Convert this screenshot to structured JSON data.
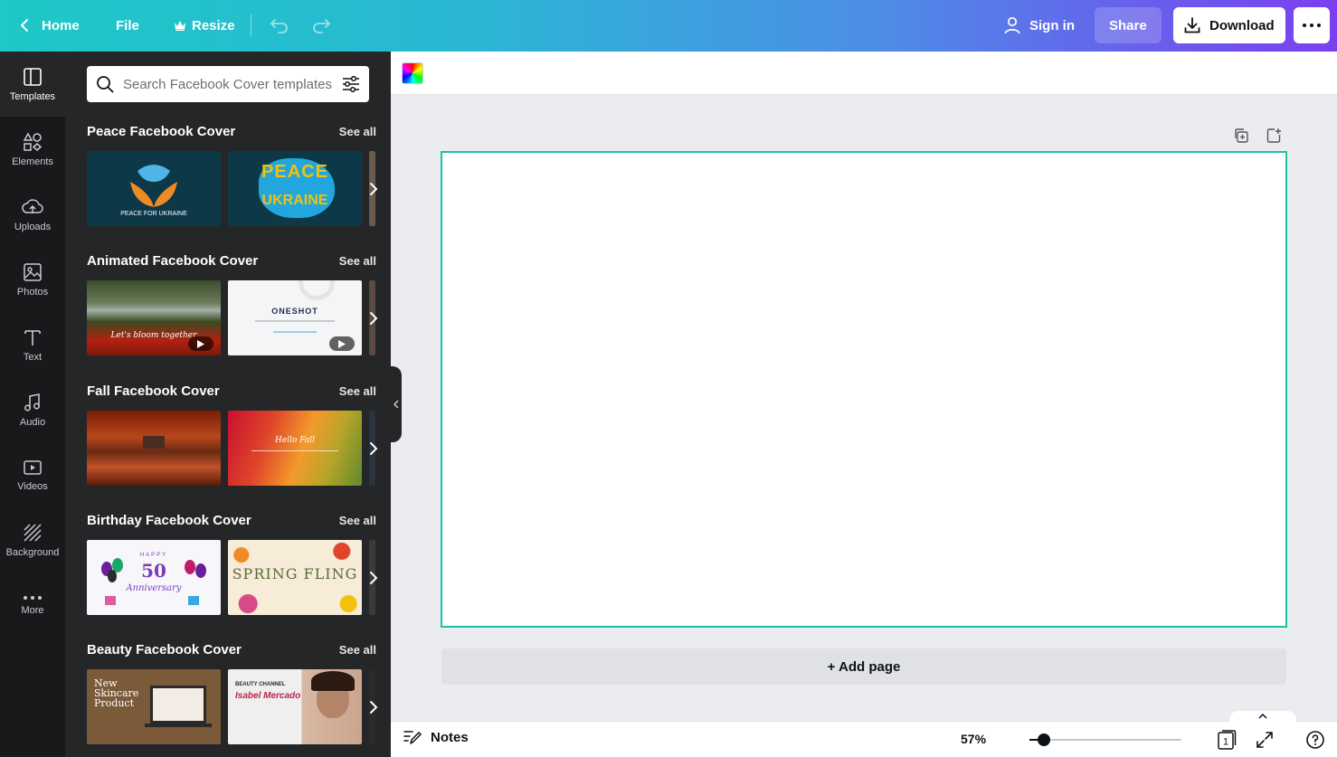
{
  "topbar": {
    "home_label": "Home",
    "file_label": "File",
    "resize_label": "Resize",
    "signin_label": "Sign in",
    "share_label": "Share",
    "download_label": "Download"
  },
  "rail": {
    "items": [
      {
        "label": "Templates",
        "icon": "templates-icon"
      },
      {
        "label": "Elements",
        "icon": "elements-icon"
      },
      {
        "label": "Uploads",
        "icon": "uploads-icon"
      },
      {
        "label": "Photos",
        "icon": "photos-icon"
      },
      {
        "label": "Text",
        "icon": "text-icon"
      },
      {
        "label": "Audio",
        "icon": "audio-icon"
      },
      {
        "label": "Videos",
        "icon": "videos-icon"
      },
      {
        "label": "Background",
        "icon": "background-icon"
      },
      {
        "label": "More",
        "icon": "more-icon"
      }
    ]
  },
  "panel": {
    "search_placeholder": "Search Facebook Cover templates",
    "see_all": "See all",
    "sections": [
      {
        "title": "Peace Facebook Cover",
        "t1_text": "PEACE FOR UKRAINE",
        "t2_text_a": "PEACE",
        "t2_text_b": "UKRAINE"
      },
      {
        "title": "Animated Facebook Cover",
        "t1_text": "Let's bloom together",
        "t2_text": "ONESHOT"
      },
      {
        "title": "Fall Facebook Cover",
        "t2_text": "Hello Fall"
      },
      {
        "title": "Birthday Facebook Cover",
        "t1_text_a": "HAPPY",
        "t1_text_b": "50",
        "t1_text_c": "Anniversary",
        "t2_text": "SPRING FLING"
      },
      {
        "title": "Beauty Facebook Cover",
        "t1_text": "New Skincare Product",
        "t2_text_a": "BEAUTY CHANNEL",
        "t2_text_b": "Isabel Mercado"
      }
    ]
  },
  "editor": {
    "add_page_label": "+ Add page"
  },
  "bottombar": {
    "notes_label": "Notes",
    "zoom_label": "57%",
    "zoom_value": 57,
    "page_count": "1"
  },
  "colors": {
    "accent_teal": "#17c3a6",
    "panel_bg": "#252627",
    "rail_bg": "#18191b"
  }
}
